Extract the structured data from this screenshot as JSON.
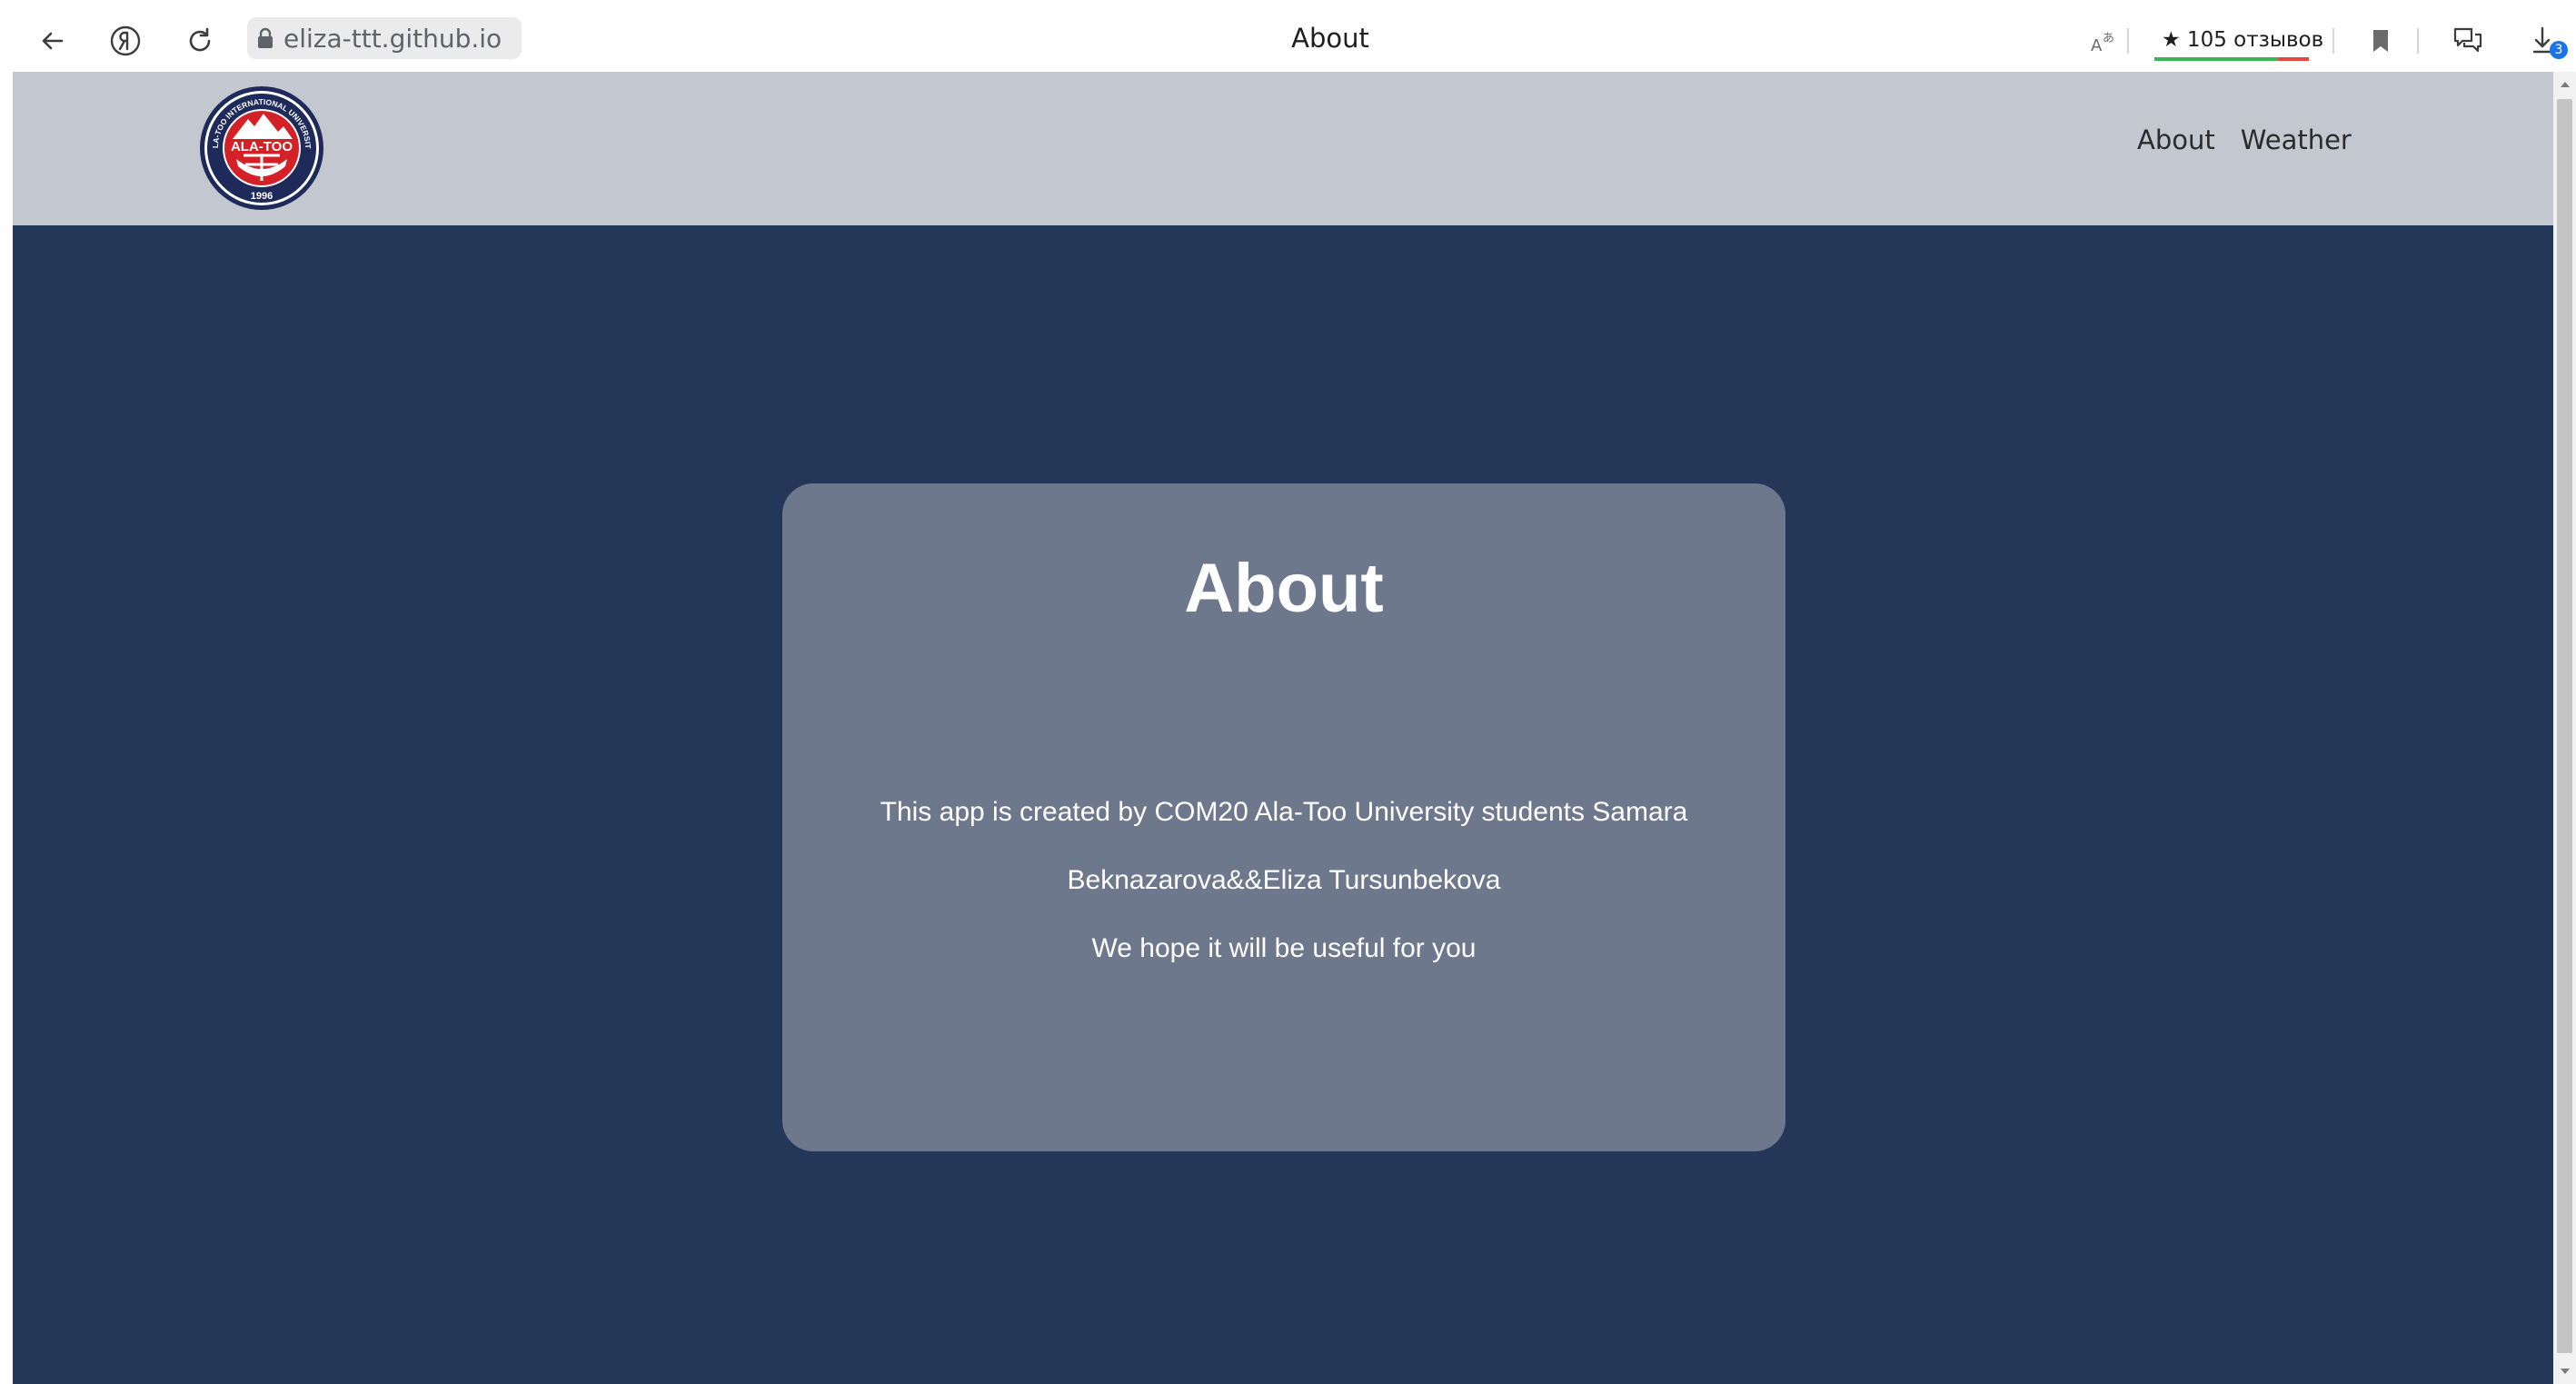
{
  "browser": {
    "url": "eliza-ttt.github.io",
    "tab_title": "About",
    "reviews_label": "★ 105 отзывов",
    "downloads_count": "3",
    "icons": {
      "back": "arrow-left-icon",
      "yandex": "yandex-logo-icon",
      "reload": "reload-icon",
      "lock": "lock-icon",
      "translate": "translate-icon",
      "bookmark": "bookmark-icon",
      "extensions": "chat-bubbles-icon",
      "downloads": "download-icon"
    }
  },
  "site": {
    "logo": {
      "alt": "Ala-Too International University logo",
      "center_text": "ALA-TOO",
      "year": "1996",
      "ring_text": "ALA-TOO INTERNATIONAL UNIVERSITY"
    },
    "nav": [
      {
        "label": "About"
      },
      {
        "label": "Weather"
      }
    ],
    "card": {
      "title": "About",
      "line1": "This app is created by COM20 Ala-Too University students Samara",
      "line2": "Beknazarova&&Eliza Tursunbekova",
      "line3": "We hope it will be useful for you"
    }
  },
  "colors": {
    "header_bg": "#c3c7cf",
    "page_bg": "#243758",
    "card_bg": "#6e788d",
    "logo_red": "#d42027",
    "logo_navy": "#1d2a5a"
  }
}
